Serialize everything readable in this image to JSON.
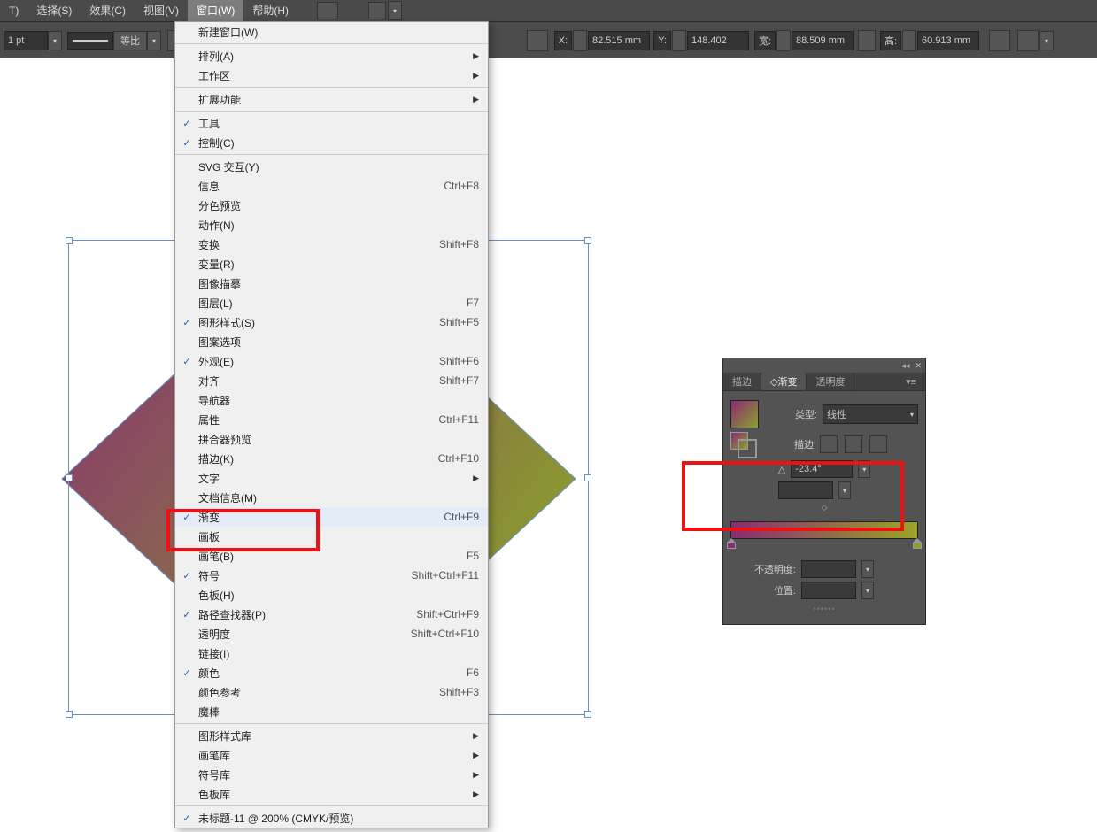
{
  "menubar": {
    "items": [
      {
        "label": "T)"
      },
      {
        "label": "选择(S)"
      },
      {
        "label": "效果(C)"
      },
      {
        "label": "视图(V)"
      },
      {
        "label": "窗口(W)",
        "active": true
      },
      {
        "label": "帮助(H)"
      }
    ]
  },
  "toolbar": {
    "stroke_weight": "1 pt",
    "stroke_style": "等比",
    "x_label": "X:",
    "x_value": "82.515 mm",
    "y_label": "Y:",
    "y_value": "148.402",
    "w_label": "宽:",
    "w_value": "88.509 mm",
    "h_label": "高:",
    "h_value": "60.913 mm"
  },
  "window_menu": {
    "groups": [
      [
        {
          "label": "新建窗口(W)"
        }
      ],
      [
        {
          "label": "排列(A)",
          "submenu": true
        },
        {
          "label": "工作区",
          "submenu": true
        }
      ],
      [
        {
          "label": "扩展功能",
          "submenu": true
        }
      ],
      [
        {
          "label": "工具",
          "checked": true
        },
        {
          "label": "控制(C)",
          "checked": true
        }
      ],
      [
        {
          "label": "SVG 交互(Y)"
        },
        {
          "label": "信息",
          "shortcut": "Ctrl+F8"
        },
        {
          "label": "分色预览"
        },
        {
          "label": "动作(N)"
        },
        {
          "label": "变换",
          "shortcut": "Shift+F8"
        },
        {
          "label": "变量(R)"
        },
        {
          "label": "图像描摹"
        },
        {
          "label": "图层(L)",
          "shortcut": "F7"
        },
        {
          "label": "图形样式(S)",
          "checked": true,
          "shortcut": "Shift+F5"
        },
        {
          "label": "图案选项"
        },
        {
          "label": "外观(E)",
          "checked": true,
          "shortcut": "Shift+F6"
        },
        {
          "label": "对齐",
          "shortcut": "Shift+F7"
        },
        {
          "label": "导航器"
        },
        {
          "label": "属性",
          "shortcut": "Ctrl+F11"
        },
        {
          "label": "拼合器预览"
        },
        {
          "label": "描边(K)",
          "shortcut": "Ctrl+F10"
        },
        {
          "label": "文字",
          "submenu": true
        },
        {
          "label": "文档信息(M)"
        },
        {
          "label": "渐变",
          "checked": true,
          "shortcut": "Ctrl+F9",
          "highlighted": true
        },
        {
          "label": "画板"
        },
        {
          "label": "画笔(B)",
          "shortcut": "F5"
        },
        {
          "label": "符号",
          "checked": true,
          "shortcut": "Shift+Ctrl+F11"
        },
        {
          "label": "色板(H)"
        },
        {
          "label": "路径查找器(P)",
          "checked": true,
          "shortcut": "Shift+Ctrl+F9"
        },
        {
          "label": "透明度",
          "shortcut": "Shift+Ctrl+F10"
        },
        {
          "label": "链接(I)"
        },
        {
          "label": "颜色",
          "checked": true,
          "shortcut": "F6"
        },
        {
          "label": "颜色参考",
          "shortcut": "Shift+F3"
        },
        {
          "label": "魔棒"
        }
      ],
      [
        {
          "label": "图形样式库",
          "submenu": true
        },
        {
          "label": "画笔库",
          "submenu": true
        },
        {
          "label": "符号库",
          "submenu": true
        },
        {
          "label": "色板库",
          "submenu": true
        }
      ],
      [
        {
          "label": "未标题-11 @ 200% (CMYK/预览)",
          "checked": true
        }
      ]
    ]
  },
  "gradient_panel": {
    "tabs": [
      {
        "label": "描边"
      },
      {
        "label": "渐变",
        "active": true
      },
      {
        "label": "透明度"
      }
    ],
    "type_label": "类型:",
    "type_value": "线性",
    "stroke_label": "描边",
    "angle_icon": "△",
    "angle_value": "-23.4°",
    "opacity_label": "不透明度:",
    "position_label": "位置:"
  }
}
